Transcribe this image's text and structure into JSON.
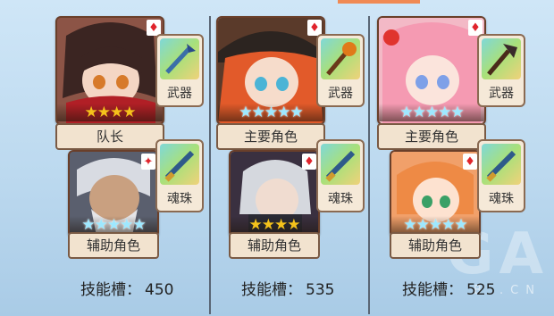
{
  "watermark": {
    "big": "GA",
    "small": "B  .CN"
  },
  "teams": [
    {
      "leader": {
        "role": "队长",
        "stars": "★★★★",
        "star_style": "gold"
      },
      "support": {
        "role": "辅助角色",
        "stars": "★★★★★",
        "star_style": "rainbow"
      },
      "weapon_label": "武器",
      "orb_label": "魂珠",
      "skill_label": "技能槽：",
      "skill_value": "450"
    },
    {
      "leader": {
        "role": "主要角色",
        "stars": "★★★★★",
        "star_style": "rainbow"
      },
      "support": {
        "role": "辅助角色",
        "stars": "★★★★",
        "star_style": "gold"
      },
      "weapon_label": "武器",
      "orb_label": "魂珠",
      "skill_label": "技能槽：",
      "skill_value": "535"
    },
    {
      "leader": {
        "role": "主要角色",
        "stars": "★★★★★",
        "star_style": "rainbow"
      },
      "support": {
        "role": "辅助角色",
        "stars": "★★★★★",
        "star_style": "rainbow"
      },
      "weapon_label": "武器",
      "orb_label": "魂珠",
      "skill_label": "技能槽：",
      "skill_value": "525"
    }
  ],
  "badge_glyph": "♦"
}
